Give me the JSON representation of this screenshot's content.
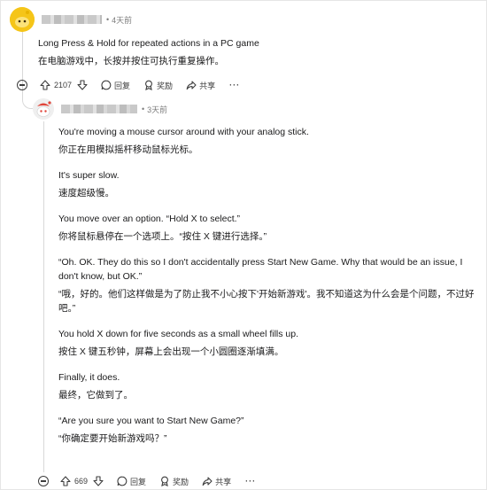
{
  "comments": [
    {
      "time": "4天前",
      "paragraphs": [
        "Long Press & Hold for repeated actions in a PC game",
        "在电脑游戏中，长按并按住可执行重复操作。"
      ],
      "votes": "2107",
      "reply_label": "回复",
      "award_label": "奖励",
      "share_label": "共享",
      "more": "···"
    },
    {
      "time": "3天前",
      "paragraphs": [
        "You're moving a mouse cursor around with your analog stick.",
        "你正在用模拟摇杆移动鼠标光标。",
        "It's super slow.",
        "速度超级慢。",
        "You move over an option. “Hold X to select.”",
        "你将鼠标悬停在一个选项上。“按住 X 键进行选择。”",
        "“Oh. OK. They do this so I don't accidentally press Start New Game. Why that would be an issue, I don't know, but OK.”",
        "“哦，好的。他们这样做是为了防止我不小心按下'开始新游戏'。我不知道这为什么会是个问题，不过好吧。”",
        "You hold X down for five seconds as a small wheel fills up.",
        "按住 X 键五秒钟，屏幕上会出现一个小圆圈逐渐填满。",
        "Finally, it does.",
        "最终，它做到了。",
        "“Are you sure you want to Start New Game?”",
        "“你确定要开始新游戏吗？”"
      ],
      "votes": "669",
      "reply_label": "回复",
      "award_label": "奖励",
      "share_label": "共享",
      "more": "···"
    }
  ],
  "colors": {
    "avatar1": "#f5c518",
    "avatar2": "#f2f2f2",
    "accent_red": "#e0453a",
    "meta_gray": "#7c7c7c"
  }
}
